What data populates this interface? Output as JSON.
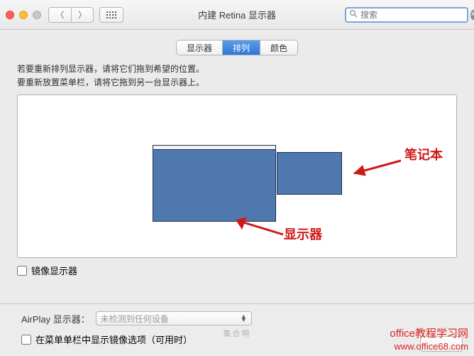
{
  "window": {
    "title": "内建 Retina 显示器"
  },
  "toolbar": {
    "search_placeholder": "搜索"
  },
  "tabs": {
    "display": "显示器",
    "arrangement": "排列",
    "color": "颜色"
  },
  "instructions": {
    "line1": "若要重新排列显示器，请将它们拖到希望的位置。",
    "line2": "要重新放置菜单栏，请将它拖到另一台显示器上。"
  },
  "annotations": {
    "laptop": "笔记本",
    "monitor": "显示器"
  },
  "options": {
    "mirror_label": "镜像显示器",
    "airplay_label": "AirPlay 显示器：",
    "airplay_value": "未检测到任何设备",
    "menubar_label": "在菜单单栏中显示镜像选项（可用时）"
  },
  "watermark": {
    "site_title": "office教程学习网",
    "site_url": "www.office68.com",
    "bg": "集合啊"
  }
}
